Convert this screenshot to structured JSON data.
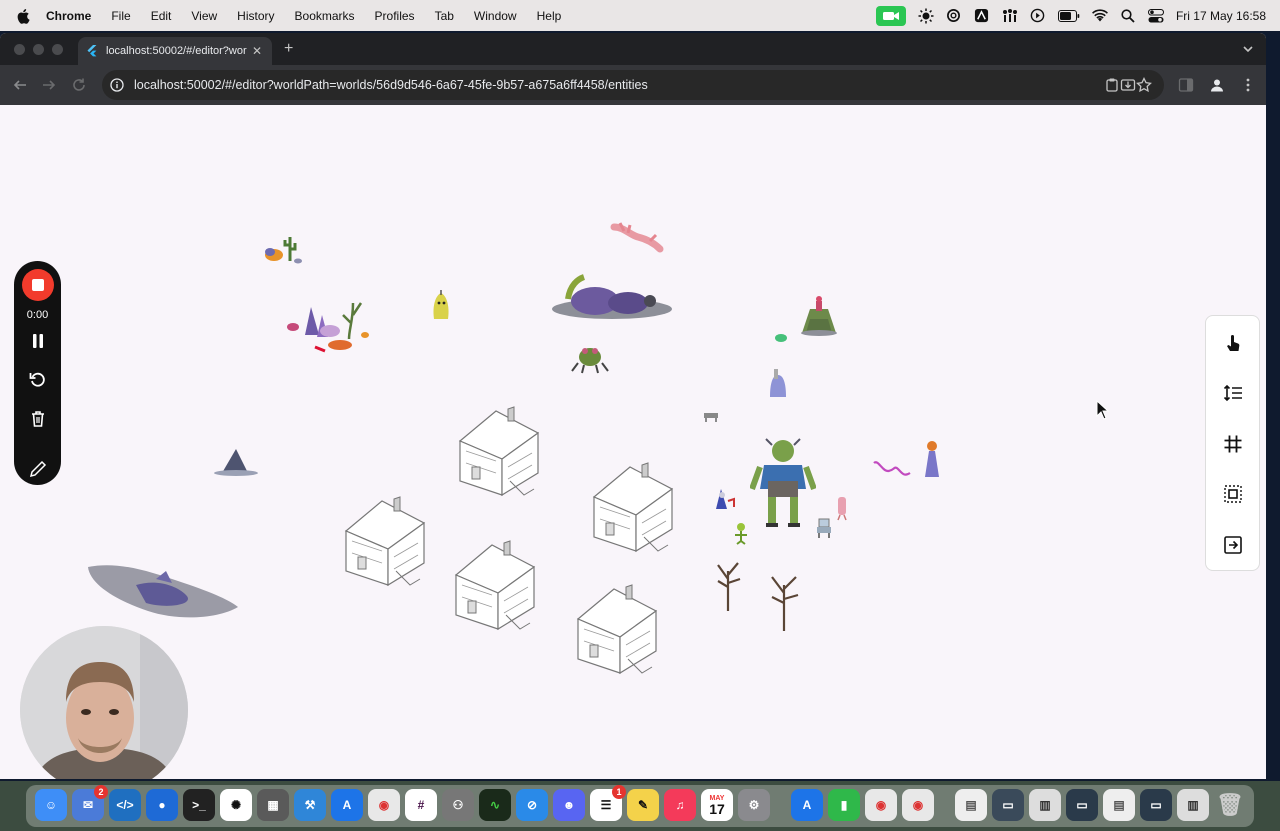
{
  "menubar": {
    "app": "Chrome",
    "items": [
      "File",
      "Edit",
      "View",
      "History",
      "Bookmarks",
      "Profiles",
      "Tab",
      "Window",
      "Help"
    ],
    "clock": "Fri 17 May 16:58"
  },
  "browser": {
    "tab_title": "localhost:50002/#/editor?wor",
    "url": "localhost:50002/#/editor?worldPath=worlds/56d9d546-6a67-45fe-9b57-a675a6ff4458/entities"
  },
  "recorder": {
    "time": "0:00",
    "colors": {
      "stop": "#f23b2c",
      "panel": "#111111"
    }
  },
  "right_toolbar": {
    "tools": [
      "touch-icon",
      "line-spacing-icon",
      "grid-icon",
      "select-frame-icon",
      "exit-icon"
    ]
  },
  "dock": {
    "mail_badge": "2",
    "reminders_badge": "1",
    "calendar_month": "MAY",
    "calendar_day": "17"
  }
}
